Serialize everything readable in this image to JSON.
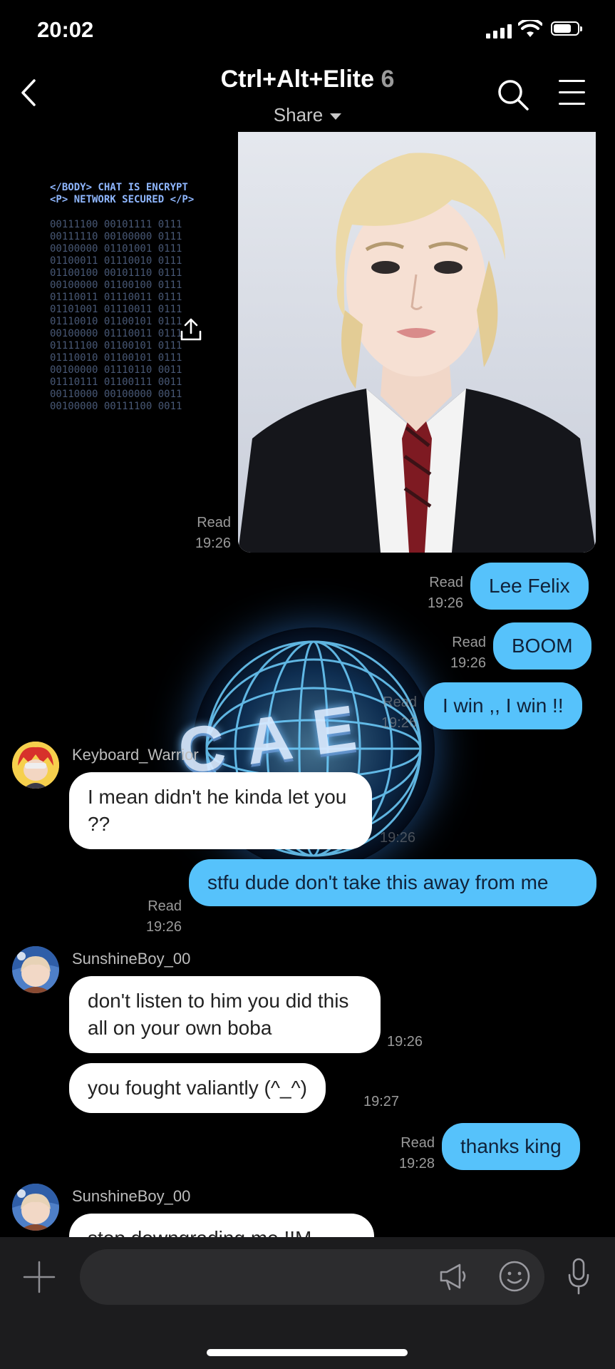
{
  "status": {
    "time": "20:02"
  },
  "header": {
    "title": "Ctrl+Alt+Elite",
    "member_count": "6",
    "share_label": "Share"
  },
  "decor": {
    "terminal_line1": "</BODY> CHAT IS ENCRYPT",
    "terminal_line2": "<P> NETWORK SECURED </P>",
    "logo_text": "CAE"
  },
  "messages": [
    {
      "id": "m1",
      "side": "mine",
      "type": "image",
      "read": "Read",
      "time": "19:26"
    },
    {
      "id": "m2",
      "side": "mine",
      "text": "Lee Felix",
      "read": "Read",
      "time": "19:26"
    },
    {
      "id": "m3",
      "side": "mine",
      "text": "BOOM",
      "read": "Read",
      "time": "19:26"
    },
    {
      "id": "m4",
      "side": "mine",
      "text": "I win ,, I win !!",
      "read": "Read",
      "time": "19:26"
    },
    {
      "id": "m5",
      "side": "theirs",
      "sender": "Keyboard_Warrior",
      "text": "I mean didn't he kinda let you ??",
      "time": "19:26"
    },
    {
      "id": "m6",
      "side": "mine",
      "text": "stfu dude don't take this away from me",
      "read": "Read",
      "time": "19:26"
    },
    {
      "id": "m7",
      "side": "theirs",
      "sender": "SunshineBoy_00",
      "text": "don't listen to him you did this all on your own boba",
      "time": "19:26"
    },
    {
      "id": "m8",
      "side": "theirs",
      "text": "you fought valiantly (^_^)",
      "time": "19:27"
    },
    {
      "id": "m9",
      "side": "mine",
      "text": "thanks king",
      "read": "Read",
      "time": "19:28"
    },
    {
      "id": "m10",
      "side": "theirs",
      "sender": "SunshineBoy_00",
      "text": "stop downgrading me !!M"
    }
  ],
  "icons": {
    "back": "chevron-left-icon",
    "search": "search-icon",
    "menu": "hamburger-icon",
    "plus": "plus-icon",
    "megaphone": "megaphone-icon",
    "emoji": "smiley-icon",
    "mic": "microphone-icon"
  },
  "colors": {
    "my_bubble": "#56c2fb",
    "their_bubble": "#ffffff",
    "background": "#000000",
    "input_bar": "#1c1c1e"
  }
}
